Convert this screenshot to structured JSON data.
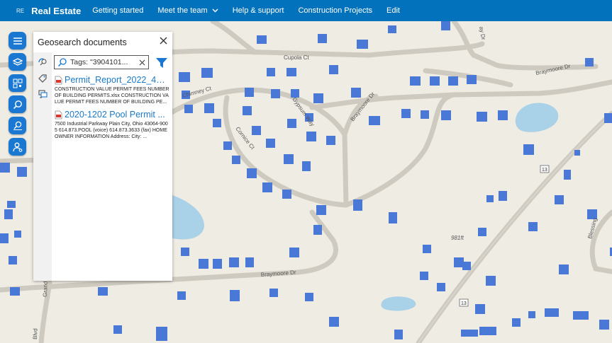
{
  "app": {
    "logo": "RE",
    "title": "Real Estate"
  },
  "nav": [
    {
      "label": "Getting started"
    },
    {
      "label": "Meet the team",
      "chevron": "chevron-down-icon"
    },
    {
      "label": "Help & support"
    },
    {
      "label": "Construction Projects"
    },
    {
      "label": "Edit"
    }
  ],
  "toolbar": [
    "menu-icon",
    "layers-icon",
    "qr-code-icon",
    "search-icon",
    "pin-search-icon",
    "user-settings-icon"
  ],
  "panel": {
    "title": "Geosearch documents",
    "search_value": "Tags: \"3904101...",
    "results": [
      {
        "name": "Permit_Report_2022_4A...",
        "snippet": "CONSTRUCTION VALUE PERMIT FEES NUMBER OF BUILDING PERMITS.xlsx CONSTRUCTION VALUE PERMIT FEES NUMBER OF BUILDING PE..."
      },
      {
        "name": "2020-1202 Pool Permit ...",
        "snippet": "7500 Industrial Parkway Plain City, Ohio 43064-9005 614.873.POOL (voice) 614.873.3633 (fax) HOMEOWNER INFORMATION Address: City: ..."
      }
    ]
  },
  "map_labels": {
    "cupola": "Cupola Ct",
    "braymoore_top": "Braymoore Dr",
    "chimney": "Chimney Ct",
    "gypsum": "Gypsum Way",
    "braymoore_mid": "Braymoore Dr",
    "cornice": "Cornice Ct",
    "braymoore_bottom": "Braymoore Dr",
    "shield1": "13",
    "shield2": "13",
    "elev": "981ft",
    "blessing": "Blessing",
    "grand": "Grand",
    "bay_top": "ay Dr",
    "blvd": "Blvd"
  },
  "colors": {
    "topbar": "#0372bc",
    "accent": "#1a78d2",
    "building": "#4a78d6",
    "water": "#a9d1e8",
    "map": "#efece4"
  }
}
